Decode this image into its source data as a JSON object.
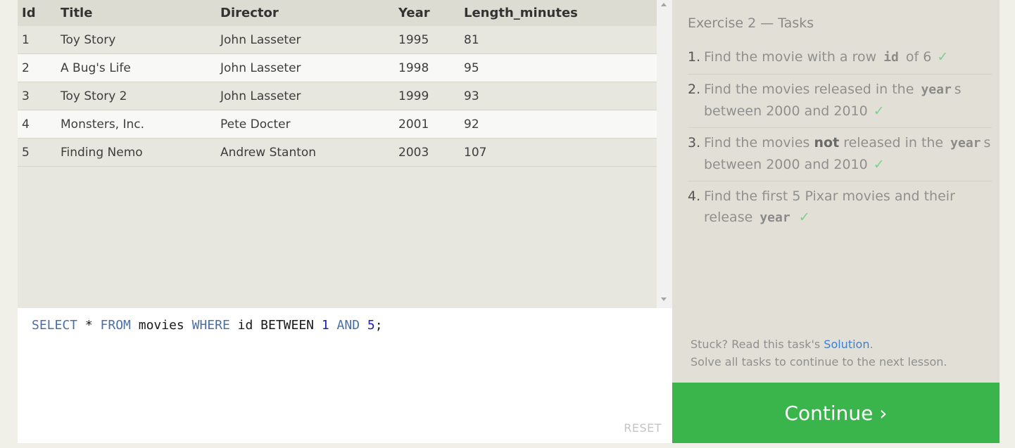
{
  "table": {
    "columns": [
      "Id",
      "Title",
      "Director",
      "Year",
      "Length_minutes"
    ],
    "rows": [
      [
        "1",
        "Toy Story",
        "John Lasseter",
        "1995",
        "81"
      ],
      [
        "2",
        "A Bug's Life",
        "John Lasseter",
        "1998",
        "95"
      ],
      [
        "3",
        "Toy Story 2",
        "John Lasseter",
        "1999",
        "93"
      ],
      [
        "4",
        "Monsters, Inc.",
        "Pete Docter",
        "2001",
        "92"
      ],
      [
        "5",
        "Finding Nemo",
        "Andrew Stanton",
        "2003",
        "107"
      ]
    ]
  },
  "editor": {
    "query_tokens": [
      {
        "text": "SELECT",
        "kind": "keyword"
      },
      {
        "text": " * ",
        "kind": "plain"
      },
      {
        "text": "FROM",
        "kind": "keyword"
      },
      {
        "text": " movies ",
        "kind": "plain"
      },
      {
        "text": "WHERE",
        "kind": "keyword"
      },
      {
        "text": " id BETWEEN ",
        "kind": "plain"
      },
      {
        "text": "1",
        "kind": "number"
      },
      {
        "text": " ",
        "kind": "plain"
      },
      {
        "text": "AND",
        "kind": "keyword"
      },
      {
        "text": " ",
        "kind": "plain"
      },
      {
        "text": "5",
        "kind": "number"
      },
      {
        "text": ";",
        "kind": "plain"
      }
    ],
    "reset_label": "RESET"
  },
  "tasks": {
    "title": "Exercise 2 — Tasks",
    "items": [
      {
        "num": "1.",
        "parts": [
          {
            "t": "Find the movie with a row ",
            "s": "text"
          },
          {
            "t": "id",
            "s": "code"
          },
          {
            "t": " of 6",
            "s": "text"
          }
        ],
        "done": true
      },
      {
        "num": "2.",
        "parts": [
          {
            "t": "Find the movies released in the ",
            "s": "text"
          },
          {
            "t": "year",
            "s": "code"
          },
          {
            "t": "s between 2000 and 2010",
            "s": "text"
          }
        ],
        "done": true
      },
      {
        "num": "3.",
        "parts": [
          {
            "t": "Find the movies ",
            "s": "text"
          },
          {
            "t": "not",
            "s": "bold"
          },
          {
            "t": " released in the ",
            "s": "text"
          },
          {
            "t": "year",
            "s": "code"
          },
          {
            "t": "s between 2000 and 2010",
            "s": "text"
          }
        ],
        "done": true
      },
      {
        "num": "4.",
        "parts": [
          {
            "t": "Find the first 5 Pixar movies and their release ",
            "s": "text"
          },
          {
            "t": "year",
            "s": "code"
          }
        ],
        "done": true
      }
    ],
    "check_glyph": "✓",
    "stuck_prefix": "Stuck? Read this task's ",
    "solution_link": "Solution",
    "stuck_suffix": ".",
    "solve_all": "Solve all tasks to continue to the next lesson."
  },
  "continue_label": "Continue ›",
  "colors": {
    "continue_bg": "#3ab54b",
    "keyword": "#4a6fa5",
    "number": "#1d1dbb",
    "check": "#7dd08c",
    "link": "#3f7fd1"
  }
}
